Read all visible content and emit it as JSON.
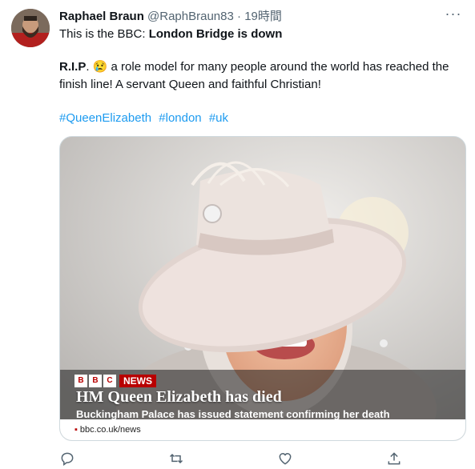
{
  "tweet": {
    "author_name": "Raphael Braun",
    "handle": "@RaphBraun83",
    "separator": "·",
    "time": "19時間",
    "line1_prefix": "This is the BBC: ",
    "line1_bold": "London Bridge is down",
    "line2_prefix": "R.I.P",
    "line2_suffix": ". 😢 a role model for many people around the world has reached the",
    "line3": "finish line! A servant Queen and faithful Christian!",
    "hashtags": [
      "#QueenElizabeth",
      "#london",
      "#uk"
    ],
    "more_label": "···"
  },
  "media": {
    "logo_letters": [
      "B",
      "B",
      "C"
    ],
    "news_tag": "NEWS",
    "headline": "HM Queen Elizabeth has died",
    "subline": "Buckingham Palace has issued statement confirming her death",
    "footer_bullet": "▪",
    "footer_url": "bbc.co.uk/news"
  },
  "colors": {
    "link": "#1d9bf0",
    "secondary_text": "#536471",
    "bbc_red": "#b80000"
  },
  "icons": [
    "reply-icon",
    "retweet-icon",
    "like-icon",
    "share-icon",
    "more-icon"
  ]
}
